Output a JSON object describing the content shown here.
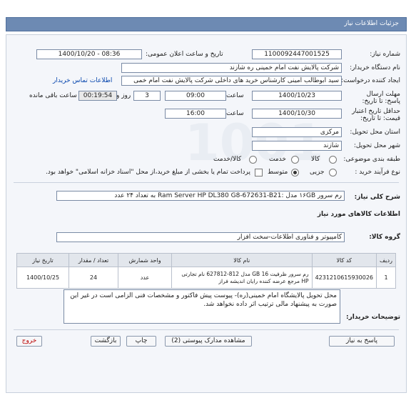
{
  "header": {
    "title": "جزئیات اطلاعات نیاز"
  },
  "fields": {
    "need_number_label": "شماره نیاز:",
    "need_number": "1100092447001525",
    "announce_label": "تاریخ و ساعت اعلان عمومی:",
    "announce_value": "1400/10/20 - 08:36",
    "buyer_label": "نام دستگاه خریدار:",
    "buyer": "شرکت پالایش نفت امام خمینی  ره  شازند",
    "creator_label": "ایجاد کننده درخواست:",
    "creator": "سید ابوطالب  امینی کارشناس خرید های داخلی  شرکت پالایش نفت امام خمی",
    "buyer_contact_link": "اطلاعات تماس خریدار",
    "send_deadline_label": "مهلت ارسال پاسخ: تا تاریخ:",
    "send_date": "1400/10/23",
    "time_label": "ساعت",
    "send_time": "09:00",
    "days": "3",
    "days_label": "روز و",
    "remaining_time": "00:19:54",
    "remaining_label": "ساعت باقی مانده",
    "price_validity_label": "حداقل تاریخ اعتبار قیمت: تا تاریخ:",
    "validity_date": "1400/10/30",
    "validity_time": "16:00",
    "province_label": "استان محل تحویل:",
    "province": "مرکزی",
    "city_label": "شهر محل تحویل:",
    "city": "شازند",
    "category_label": "طبقه بندی موضوعی:",
    "category_options": [
      "کالا",
      "خدمت",
      "کالا/خدمت"
    ],
    "process_label": "نوع فرآیند خرید :",
    "process_options": [
      "جزیی",
      "متوسط"
    ],
    "payment_note": "پرداخت تمام یا بخشی از مبلغ خرید،از محل \"اسناد خزانه اسلامی\" خواهد بود."
  },
  "description": {
    "label": "شرح کلی نیاز:",
    "text": "رم سرور ۱۶GB مدل :Ram Server HP DL380 G8-672631-B21 به تعداد ۲۴ عدد"
  },
  "goods": {
    "section_title": "اطلاعات کالاهای مورد نیاز",
    "group_label": "گروه کالا:",
    "group": "کامپیوتر و فناوری اطلاعات-سخت افزار",
    "columns": [
      "ردیف",
      "کد کالا",
      "نام کالا",
      "واحد شمارش",
      "تعداد / مقدار",
      "تاریخ نیاز"
    ],
    "rows": [
      {
        "index": "1",
        "code": "4231210615930026",
        "name": "رم سرور ظرفیت 16 GB مدل 812-627812 نام تجارتی HP مرجع عرضه کننده رایان اندیشه فراز",
        "unit": "عدد",
        "qty": "24",
        "date": "1400/10/25"
      }
    ]
  },
  "buyer_notes": {
    "label": "توضیحات خریدار:",
    "text": "محل تحویل پالایشگاه امام خمینی(ره)- پیوست پیش فاکتور و مشخصات فنی الزامی است در غیر این صورت به پیشنهاد مالی ترتیب اثر داده نخواهد شد."
  },
  "actions": {
    "reply": "پاسخ به نیاز",
    "attachments": "مشاهده مدارک پیوستی (2)",
    "print": "چاپ",
    "back": "بازگشت",
    "exit": "خروج"
  }
}
